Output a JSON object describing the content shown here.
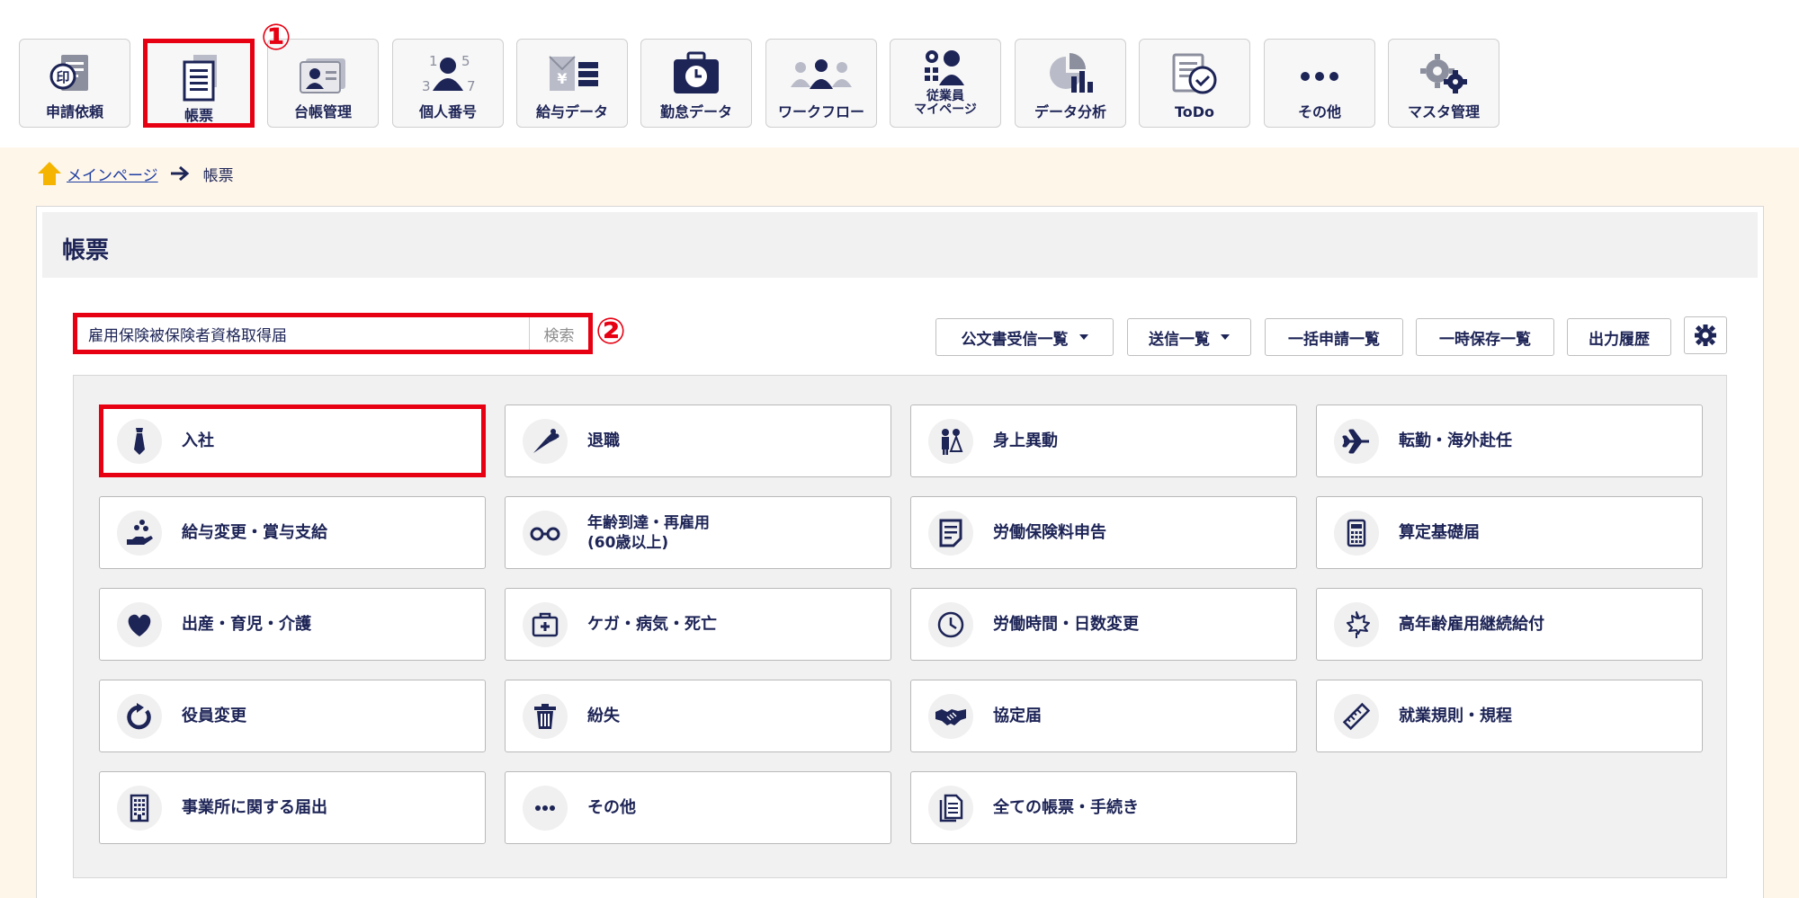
{
  "colors": {
    "navy": "#1d2456",
    "highlight": "#e60012",
    "link": "#1e3ea1",
    "background": "#fff6ea"
  },
  "nav": [
    {
      "label": "申請依頼",
      "icon": "stamp-document-icon"
    },
    {
      "label": "帳票",
      "icon": "document-icon",
      "active": true
    },
    {
      "label": "台帳管理",
      "icon": "id-card-icon"
    },
    {
      "label": "個人番号",
      "icon": "person-numbers-icon"
    },
    {
      "label": "給与データ",
      "icon": "yen-envelope-icon"
    },
    {
      "label": "勤怠データ",
      "icon": "clock-bag-icon"
    },
    {
      "label": "ワークフロー",
      "icon": "workflow-people-icon"
    },
    {
      "label": "従業員\nマイページ",
      "icon": "employee-page-icon"
    },
    {
      "label": "データ分析",
      "icon": "chart-analysis-icon"
    },
    {
      "label": "ToDo",
      "icon": "todo-check-icon"
    },
    {
      "label": "その他",
      "icon": "more-dots-icon"
    },
    {
      "label": "マスタ管理",
      "icon": "gears-icon"
    }
  ],
  "markers": {
    "one": "①",
    "two": "②"
  },
  "breadcrumb": {
    "home": "メインページ",
    "current": "帳票"
  },
  "panel": {
    "title": "帳票"
  },
  "search": {
    "value": "雇用保険被保険者資格取得届",
    "button": "検索"
  },
  "toolbar": {
    "received": "公文書受信一覧",
    "sent": "送信一覧",
    "batch": "一括申請一覧",
    "temp_saved": "一時保存一覧",
    "output_history": "出力履歴"
  },
  "categories": [
    {
      "label": "入社",
      "icon": "necktie-icon",
      "active": true
    },
    {
      "label": "退職",
      "icon": "bouquet-icon"
    },
    {
      "label": "身上異動",
      "icon": "couple-icon"
    },
    {
      "label": "転勤・海外赴任",
      "icon": "airplane-icon"
    },
    {
      "label": "給与変更・賞与支給",
      "icon": "hand-coins-icon"
    },
    {
      "label": "年齢到達・再雇用\n(60歳以上)",
      "icon": "glasses-icon"
    },
    {
      "label": "労働保険料申告",
      "icon": "document-lines-icon"
    },
    {
      "label": "算定基礎届",
      "icon": "calculator-icon"
    },
    {
      "label": "出産・育児・介護",
      "icon": "heart-icon"
    },
    {
      "label": "ケガ・病気・死亡",
      "icon": "first-aid-icon"
    },
    {
      "label": "労働時間・日数変更",
      "icon": "clock-icon"
    },
    {
      "label": "高年齢雇用継続給付",
      "icon": "maple-leaf-icon"
    },
    {
      "label": "役員変更",
      "icon": "rotate-icon"
    },
    {
      "label": "紛失",
      "icon": "trash-icon"
    },
    {
      "label": "協定届",
      "icon": "handshake-icon"
    },
    {
      "label": "就業規則・規程",
      "icon": "ruler-icon"
    },
    {
      "label": "事業所に関する届出",
      "icon": "building-icon"
    },
    {
      "label": "その他",
      "icon": "more-dots-icon"
    },
    {
      "label": "全ての帳票・手続き",
      "icon": "documents-icon"
    }
  ]
}
